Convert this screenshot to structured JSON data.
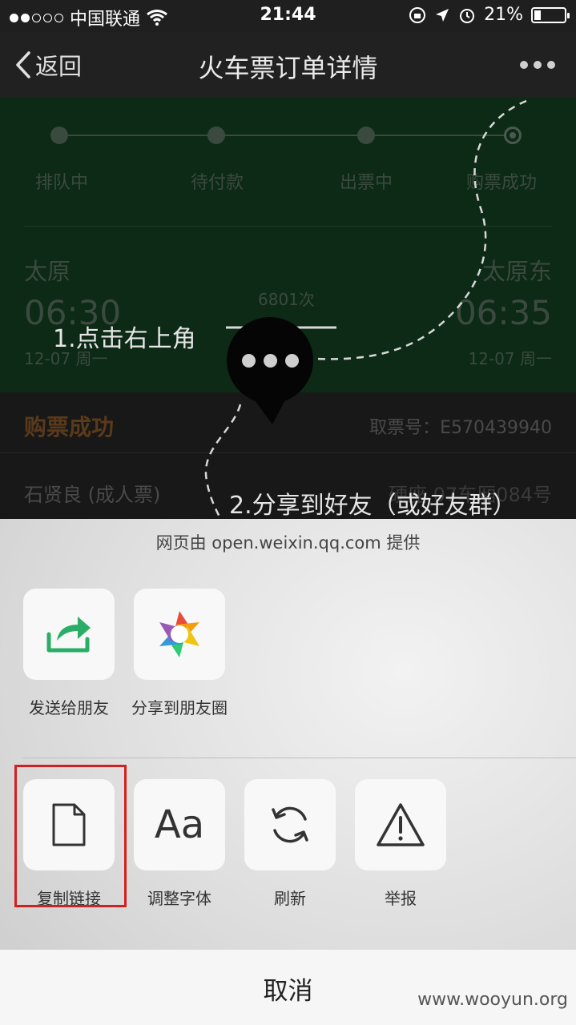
{
  "status_bar": {
    "carrier": "中国联通",
    "time": "21:44",
    "battery": "21%",
    "battery_level": 0.21,
    "signal_dots": [
      true,
      true,
      false,
      false,
      false
    ]
  },
  "nav": {
    "back_label": "返回",
    "title": "火车票订单详情"
  },
  "progress": {
    "steps": [
      "排队中",
      "待付款",
      "出票中",
      "购票成功"
    ]
  },
  "trip": {
    "from_city": "太原",
    "from_time": "06:30",
    "from_date": "12-07 周一",
    "to_city": "太原东",
    "to_time": "06:35",
    "to_date": "12-07 周一",
    "train_no": "6801次"
  },
  "order": {
    "status": "购票成功",
    "ticket_no": "取票号：E570439940",
    "passenger": "石贤良 (成人票)",
    "seat": "硬座 07车厢084号"
  },
  "guide": {
    "step1": "1.点击右上角",
    "step2": "2.分享到好友（或好友群）"
  },
  "sheet": {
    "provider": "网页由 open.weixin.qq.com 提供",
    "share_items": [
      {
        "label": "发送给朋友",
        "icon": "send-to-friend-icon"
      },
      {
        "label": "分享到朋友圈",
        "icon": "moments-icon"
      }
    ],
    "action_items": [
      {
        "label": "复制链接",
        "icon": "document-icon"
      },
      {
        "label": "调整字体",
        "icon": "font-icon",
        "glyph": "Aa"
      },
      {
        "label": "刷新",
        "icon": "refresh-icon"
      },
      {
        "label": "举报",
        "icon": "warning-icon"
      }
    ],
    "cancel_label": "取消"
  },
  "watermark": "www.wooyun.org",
  "colors": {
    "highlight": "#d41f1f",
    "share_green": "#2aae67"
  }
}
